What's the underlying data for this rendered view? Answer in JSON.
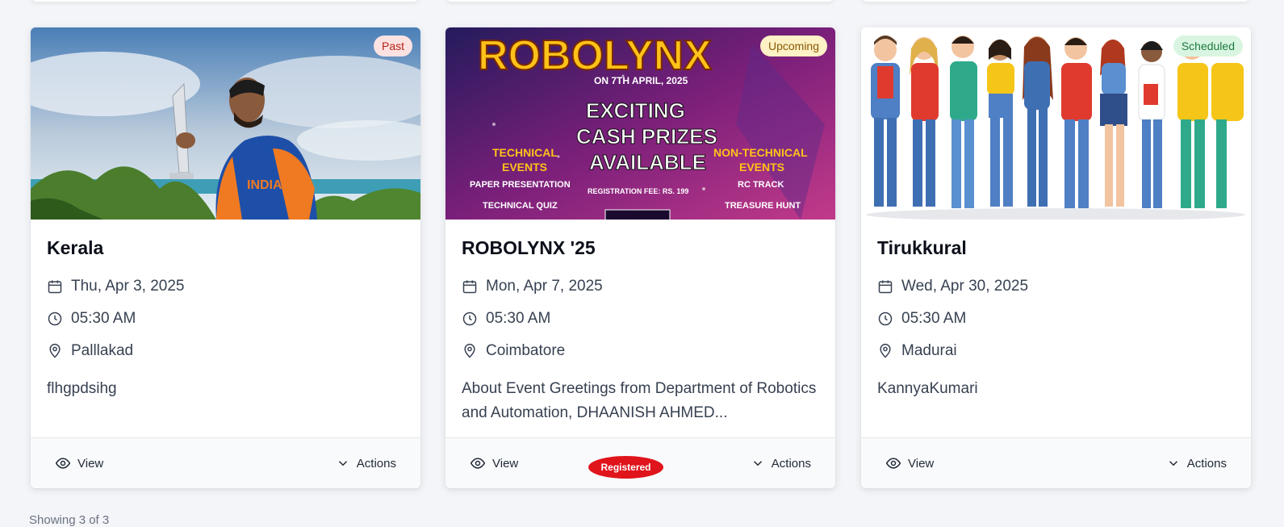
{
  "events": [
    {
      "status": "Past",
      "title": "Kerala",
      "date": "Thu, Apr 3, 2025",
      "time": "05:30 AM",
      "location": "Palllakad",
      "description": "flhgpdsihg",
      "view_label": "View",
      "actions_label": "Actions"
    },
    {
      "status": "Upcoming",
      "title": "ROBOLYNX '25",
      "date": "Mon, Apr 7, 2025",
      "time": "05:30 AM",
      "location": "Coimbatore",
      "description": "About Event Greetings from Department of Robotics and Automation, DHAANISH AHMED...",
      "view_label": "View",
      "actions_label": "Actions",
      "registered_label": "Registered"
    },
    {
      "status": "Scheduled",
      "title": "Tirukkural",
      "date": "Wed, Apr 30, 2025",
      "time": "05:30 AM",
      "location": "Madurai",
      "description": "KannyaKumari",
      "view_label": "View",
      "actions_label": "Actions"
    }
  ],
  "poster": {
    "brand": "ROBOLYNX",
    "date_line": "ON 7TH APRIL, 2025",
    "headline": [
      "EXCITING",
      "CASH PRIZES",
      "AVAILABLE"
    ],
    "technical": [
      "TECHNICAL",
      "EVENTS"
    ],
    "technical_items": [
      "PAPER PRESENTATION",
      "TECHNICAL QUIZ"
    ],
    "non_technical": [
      "NON-TECHNICAL",
      "EVENTS"
    ],
    "non_technical_items": [
      "RC TRACK",
      "TREASURE HUNT"
    ],
    "fee": "REGISTRATION FEE: RS. 199"
  },
  "jersey_text": "INDIA",
  "pagination": {
    "showing": "Showing 3 of 3"
  },
  "colors": {
    "page_bg": "#f3f5f8",
    "registered_badge": "#e0141b"
  },
  "icons": [
    "calendar-icon",
    "clock-icon",
    "location-pin-icon",
    "eye-icon",
    "chevron-down-icon"
  ]
}
